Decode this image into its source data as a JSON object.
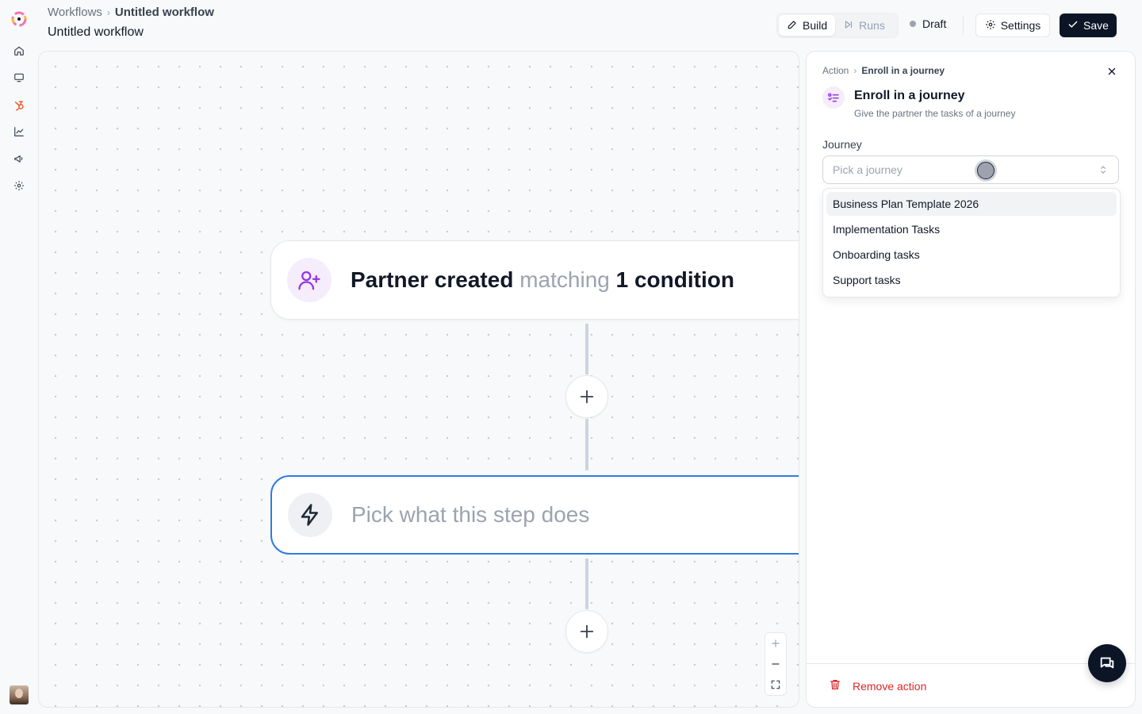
{
  "breadcrumb": {
    "root": "Workflows",
    "current": "Untitled workflow"
  },
  "page_title": "Untitled workflow",
  "header": {
    "tabs": [
      {
        "label": "Build",
        "icon": "pencil-icon",
        "active": true
      },
      {
        "label": "Runs",
        "icon": "skip-forward-icon",
        "active": false
      }
    ],
    "status": "Draft",
    "settings_label": "Settings",
    "save_label": "Save"
  },
  "sidebar": {
    "items": [
      {
        "name": "home",
        "icon": "home-icon"
      },
      {
        "name": "monitor",
        "icon": "monitor-icon"
      },
      {
        "name": "workflows",
        "icon": "hubspot-icon",
        "active": true
      },
      {
        "name": "analytics",
        "icon": "chart-icon"
      },
      {
        "name": "campaigns",
        "icon": "megaphone-icon"
      },
      {
        "name": "settings",
        "icon": "gear-icon"
      }
    ]
  },
  "canvas": {
    "trigger": {
      "bold1": "Partner created",
      "muted": "matching",
      "bold2": "1 condition"
    },
    "action": {
      "placeholder": "Pick what this step does"
    }
  },
  "panel": {
    "crumb_root": "Action",
    "crumb_current": "Enroll in a journey",
    "title": "Enroll in a journey",
    "subtitle": "Give the partner the tasks of a journey",
    "field_label": "Journey",
    "select_placeholder": "Pick a journey",
    "options": [
      "Business Plan Template 2026",
      "Implementation Tasks",
      "Onboarding tasks",
      "Support tasks"
    ],
    "remove_label": "Remove action"
  },
  "colors": {
    "accent": "#2f7be6",
    "brand_dark": "#0b1526",
    "danger": "#dc2626",
    "purple": "#9333ea",
    "hubspot": "#f05a28"
  }
}
